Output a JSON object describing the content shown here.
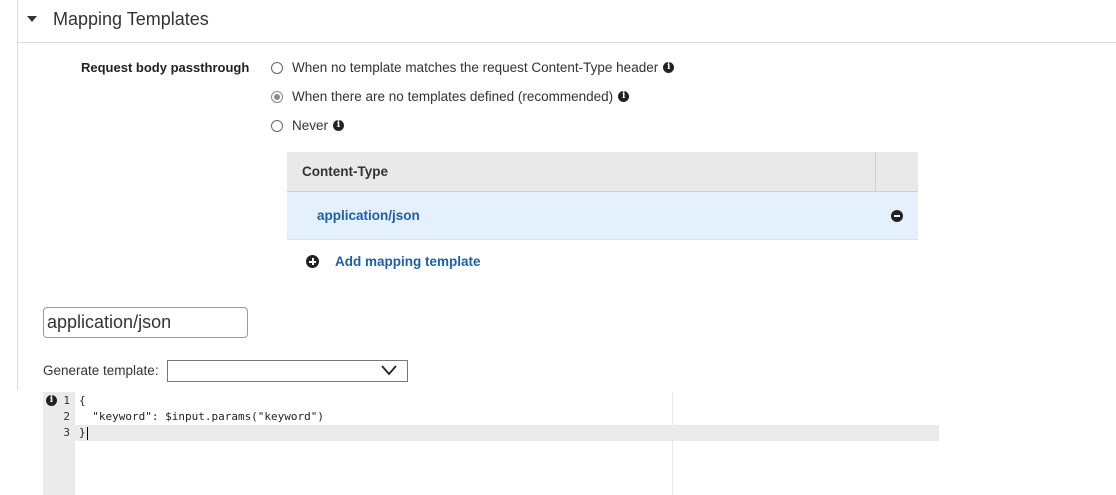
{
  "section": {
    "title": "Mapping Templates"
  },
  "passthrough": {
    "label": "Request body passthrough",
    "options": [
      {
        "label": "When no template matches the request Content-Type header",
        "selected": false
      },
      {
        "label": "When there are no templates defined (recommended)",
        "selected": true
      },
      {
        "label": "Never",
        "selected": false
      }
    ]
  },
  "content_types": {
    "header": "Content-Type",
    "rows": [
      {
        "value": "application/json"
      }
    ]
  },
  "add_mapping": {
    "label": "Add mapping template"
  },
  "content_type_input": {
    "value": "application/json"
  },
  "generate_template": {
    "label": "Generate template:",
    "selected": ""
  },
  "editor": {
    "lines": [
      {
        "number": "1",
        "text": "{"
      },
      {
        "number": "2",
        "text": "  \"keyword\": $input.params(\"keyword\")"
      },
      {
        "number": "3",
        "text": "}"
      }
    ]
  },
  "icons": {
    "section_toggle": "caret-down-icon",
    "info": "info-icon",
    "remove": "remove-circle-icon",
    "add": "add-circle-icon",
    "dropdown": "chevron-down-icon"
  }
}
